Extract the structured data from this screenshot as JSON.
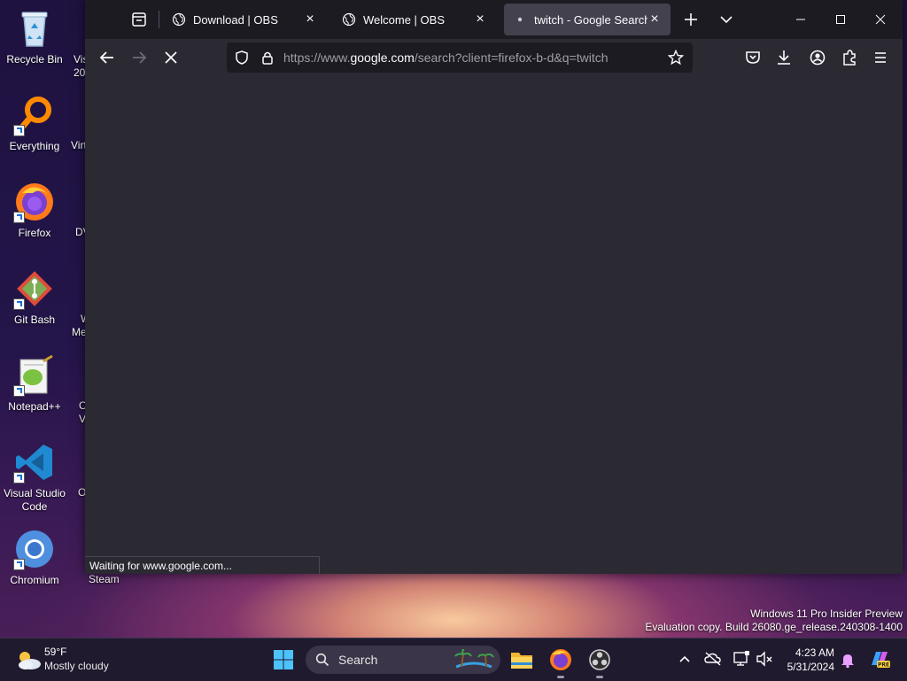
{
  "desktop": {
    "icons": [
      {
        "label": "Recycle Bin"
      },
      {
        "label": "Everything"
      },
      {
        "label": "Firefox"
      },
      {
        "label": "Git Bash"
      },
      {
        "label": "Notepad++"
      },
      {
        "label": "Visual Studio Code"
      },
      {
        "label": "Chromium"
      }
    ],
    "partial_labels": [
      "Vis",
      "20",
      "Virt",
      "DV",
      "W",
      "Me",
      "O",
      "V",
      "O",
      "Steam"
    ]
  },
  "browser": {
    "tabs": [
      {
        "title": "Download | OBS",
        "active": false
      },
      {
        "title": "Welcome | OBS",
        "active": false
      },
      {
        "title": "twitch - Google Search",
        "active": true
      }
    ],
    "url_prefix": "https://www.",
    "url_host": "google.com",
    "url_path": "/search?client=firefox-b-d&q=twitch",
    "status_text": "Waiting for www.google.com..."
  },
  "watermark": {
    "line1": "Windows 11 Pro Insider Preview",
    "line2": "Evaluation copy. Build 26080.ge_release.240308-1400"
  },
  "taskbar": {
    "weather_temp": "59°F",
    "weather_desc": "Mostly cloudy",
    "search_label": "Search",
    "time": "4:23 AM",
    "date": "5/31/2024"
  },
  "colors": {
    "tab_active": "#42414d",
    "toolbar": "#2b2a33",
    "tabstrip": "#1c1b22"
  }
}
